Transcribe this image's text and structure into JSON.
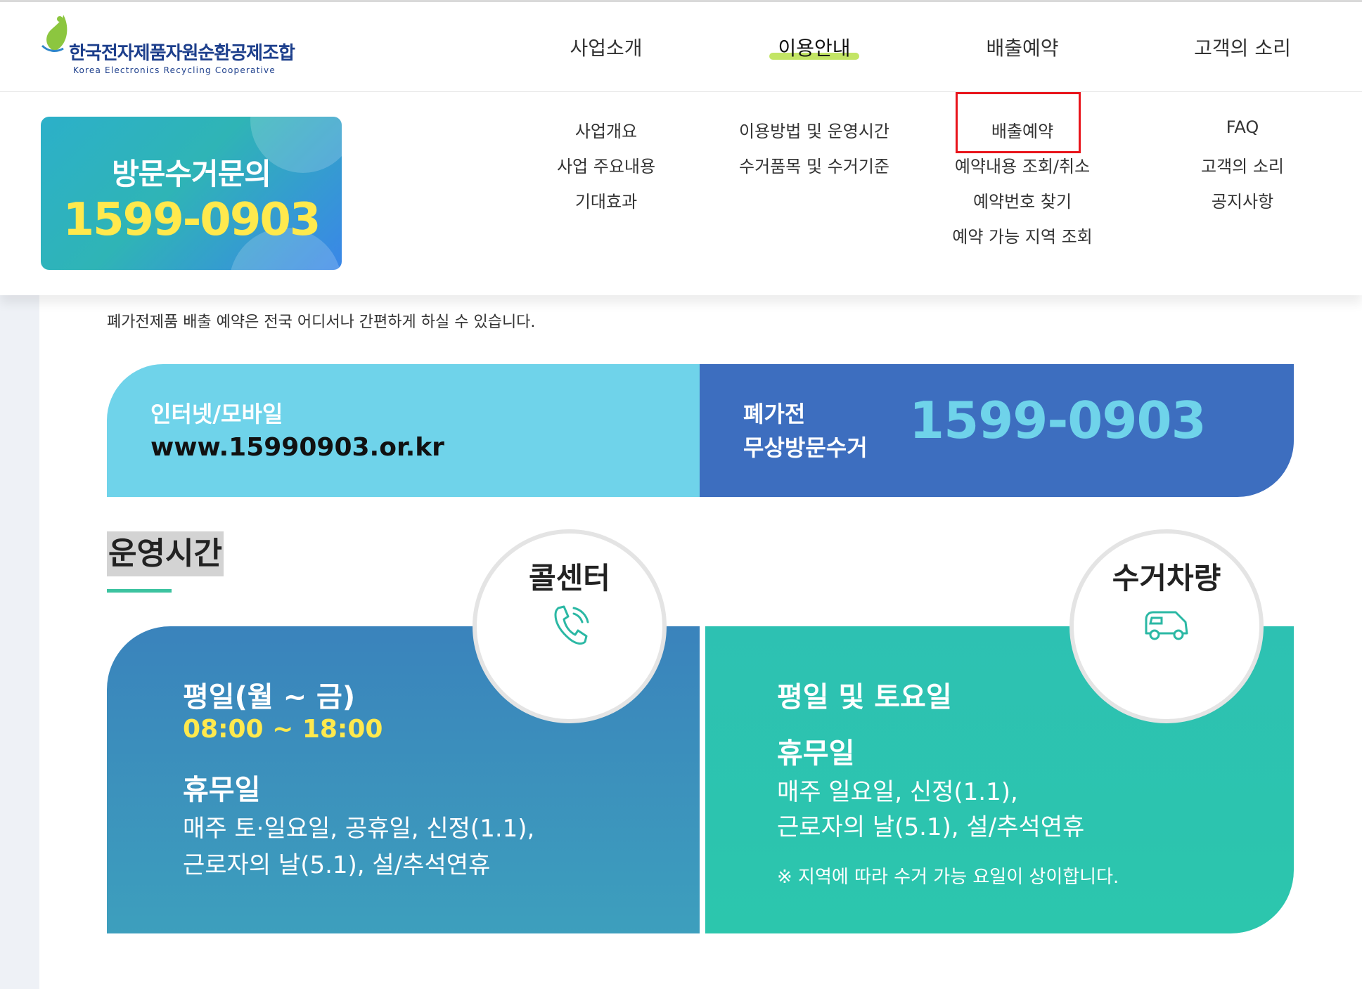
{
  "header": {
    "logo": {
      "korean": "한국전자제품자원순환공제조합",
      "english": "Korea Electronics Recycling Cooperative"
    },
    "nav": [
      {
        "label": "사업소개"
      },
      {
        "label": "이용안내",
        "active": true
      },
      {
        "label": "배출예약"
      },
      {
        "label": "고객의 소리"
      }
    ]
  },
  "dropdown": {
    "promo": {
      "title": "방문수거문의",
      "phone": "1599-0903"
    },
    "columns": [
      {
        "items": [
          "사업개요",
          "사업 주요내용",
          "기대효과"
        ]
      },
      {
        "items": [
          "이용방법 및 운영시간",
          "수거품목 및 수거기준"
        ]
      },
      {
        "items": [
          "배출예약",
          "예약내용 조회/취소",
          "예약번호 찾기",
          "예약 가능 지역 조회"
        ]
      },
      {
        "items": [
          "FAQ",
          "고객의 소리",
          "공지사항"
        ]
      }
    ],
    "highlighted_item": "배출예약"
  },
  "main": {
    "intro": "폐가전제품 배출 예약은 전국 어디서나 간편하게 하실 수 있습니다.",
    "banner": {
      "left_label": "인터넷/모바일",
      "url": "www.15990903.or.kr",
      "right_label_line1": "폐가전",
      "right_label_line2": "무상방문수거",
      "phone": "1599-0903"
    },
    "section_title": "운영시간",
    "call_center": {
      "badge_title": "콜센터",
      "icon": "phone-icon",
      "weekday_label": "평일(월 ~ 금)",
      "hours": "08:00 ~ 18:00",
      "holiday_title": "휴무일",
      "holiday_line1": "매주 토·일요일, 공휴일, 신정(1.1),",
      "holiday_line2": "근로자의 날(5.1), 설/추석연휴"
    },
    "truck": {
      "badge_title": "수거차량",
      "icon": "truck-icon",
      "days_label": "평일 및 토요일",
      "holiday_title": "휴무일",
      "holiday_line1": "매주 일요일, 신정(1.1),",
      "holiday_line2": "근로자의 날(5.1), 설/추석연휴",
      "note": "※ 지역에 따라 수거 가능 요일이 상이합니다."
    }
  },
  "colors": {
    "accent_yellow": "#ffe94d",
    "banner_light": "#6fd3ea",
    "banner_dark": "#3d6ebf",
    "section_underline": "#3cc3a0",
    "highlight_red": "#e8141b"
  }
}
